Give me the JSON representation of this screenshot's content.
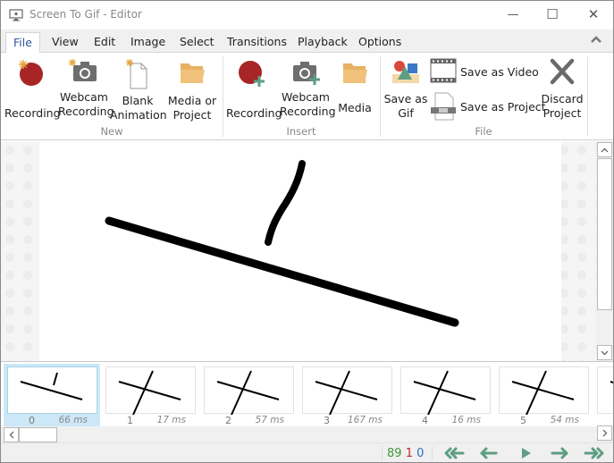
{
  "window": {
    "title": "Screen To Gif - Editor",
    "controls": {
      "minimize": "—",
      "maximize": "☐",
      "close": "✕"
    }
  },
  "menu": {
    "items": [
      {
        "label": "File",
        "active": true
      },
      {
        "label": "View"
      },
      {
        "label": "Edit"
      },
      {
        "label": "Image"
      },
      {
        "label": "Select"
      },
      {
        "label": "Transitions"
      },
      {
        "label": "Playback"
      },
      {
        "label": "Options"
      }
    ],
    "collapse_icon": "chevron-up"
  },
  "ribbon": {
    "groups": [
      {
        "label": "New",
        "buttons": [
          {
            "label": "Recording",
            "icon": "new-recording-icon"
          },
          {
            "label1": "Webcam",
            "label2": "Recording",
            "icon": "new-webcam-icon"
          },
          {
            "label1": "Blank",
            "label2": "Animation",
            "icon": "blank-page-icon"
          },
          {
            "label1": "Media or",
            "label2": "Project",
            "icon": "folder-icon"
          }
        ]
      },
      {
        "label": "Insert",
        "buttons": [
          {
            "label": "Recording",
            "icon": "insert-recording-icon"
          },
          {
            "label1": "Webcam",
            "label2": "Recording",
            "icon": "insert-webcam-icon"
          },
          {
            "label": "Media",
            "icon": "folder-icon"
          }
        ]
      },
      {
        "label": "File",
        "buttons": [
          {
            "label1": "Save as",
            "label2": "Gif",
            "icon": "image-shapes-icon"
          },
          {
            "label": "Save as Video",
            "icon": "film-icon"
          },
          {
            "label": "Save as Project",
            "icon": "project-file-icon"
          },
          {
            "label1": "Discard",
            "label2": "Project",
            "icon": "x-icon"
          }
        ]
      }
    ]
  },
  "timeline": {
    "frames": [
      {
        "index": "0",
        "delay": "66 ms",
        "selected": true
      },
      {
        "index": "1",
        "delay": "17 ms"
      },
      {
        "index": "2",
        "delay": "57 ms"
      },
      {
        "index": "3",
        "delay": "167 ms"
      },
      {
        "index": "4",
        "delay": "16 ms"
      },
      {
        "index": "5",
        "delay": "54 ms"
      }
    ]
  },
  "status": {
    "total_frames": "89",
    "selected_count": "1",
    "current_index": "0",
    "colors": {
      "total": "#3a9a3a",
      "selected": "#c0282d",
      "current": "#2b6cc4"
    }
  },
  "colors": {
    "accent": "#2b579a",
    "nav_arrow": "#5e9e83",
    "record_red": "#a82525",
    "folder": "#f0c27b"
  }
}
